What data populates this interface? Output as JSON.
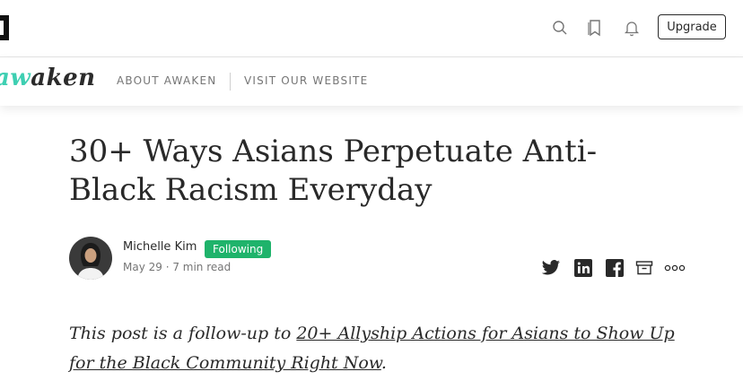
{
  "header": {
    "search_icon": "search-icon",
    "bookmark_icon": "bookmark-icon",
    "bell_icon": "bell-icon",
    "upgrade_label": "Upgrade"
  },
  "publication": {
    "name_accent": "aw",
    "name_rest": "aken",
    "nav": [
      "ABOUT AWAKEN",
      "VISIT OUR WEBSITE"
    ]
  },
  "article": {
    "title": "30+ Ways Asians Perpetuate Anti-Black Racism Everyday",
    "author": "Michelle Kim",
    "follow_status": "Following",
    "meta": "May 29 · 7 min read",
    "lede_before": "This post is a follow-up to ",
    "lede_link": "20+ Allyship Actions for Asians to Show Up for the Black Community Right Now",
    "lede_after": "."
  },
  "colors": {
    "accent": "#3ecfb2",
    "following_bg": "#1fb36b",
    "text": "#292929",
    "muted": "#757575"
  }
}
